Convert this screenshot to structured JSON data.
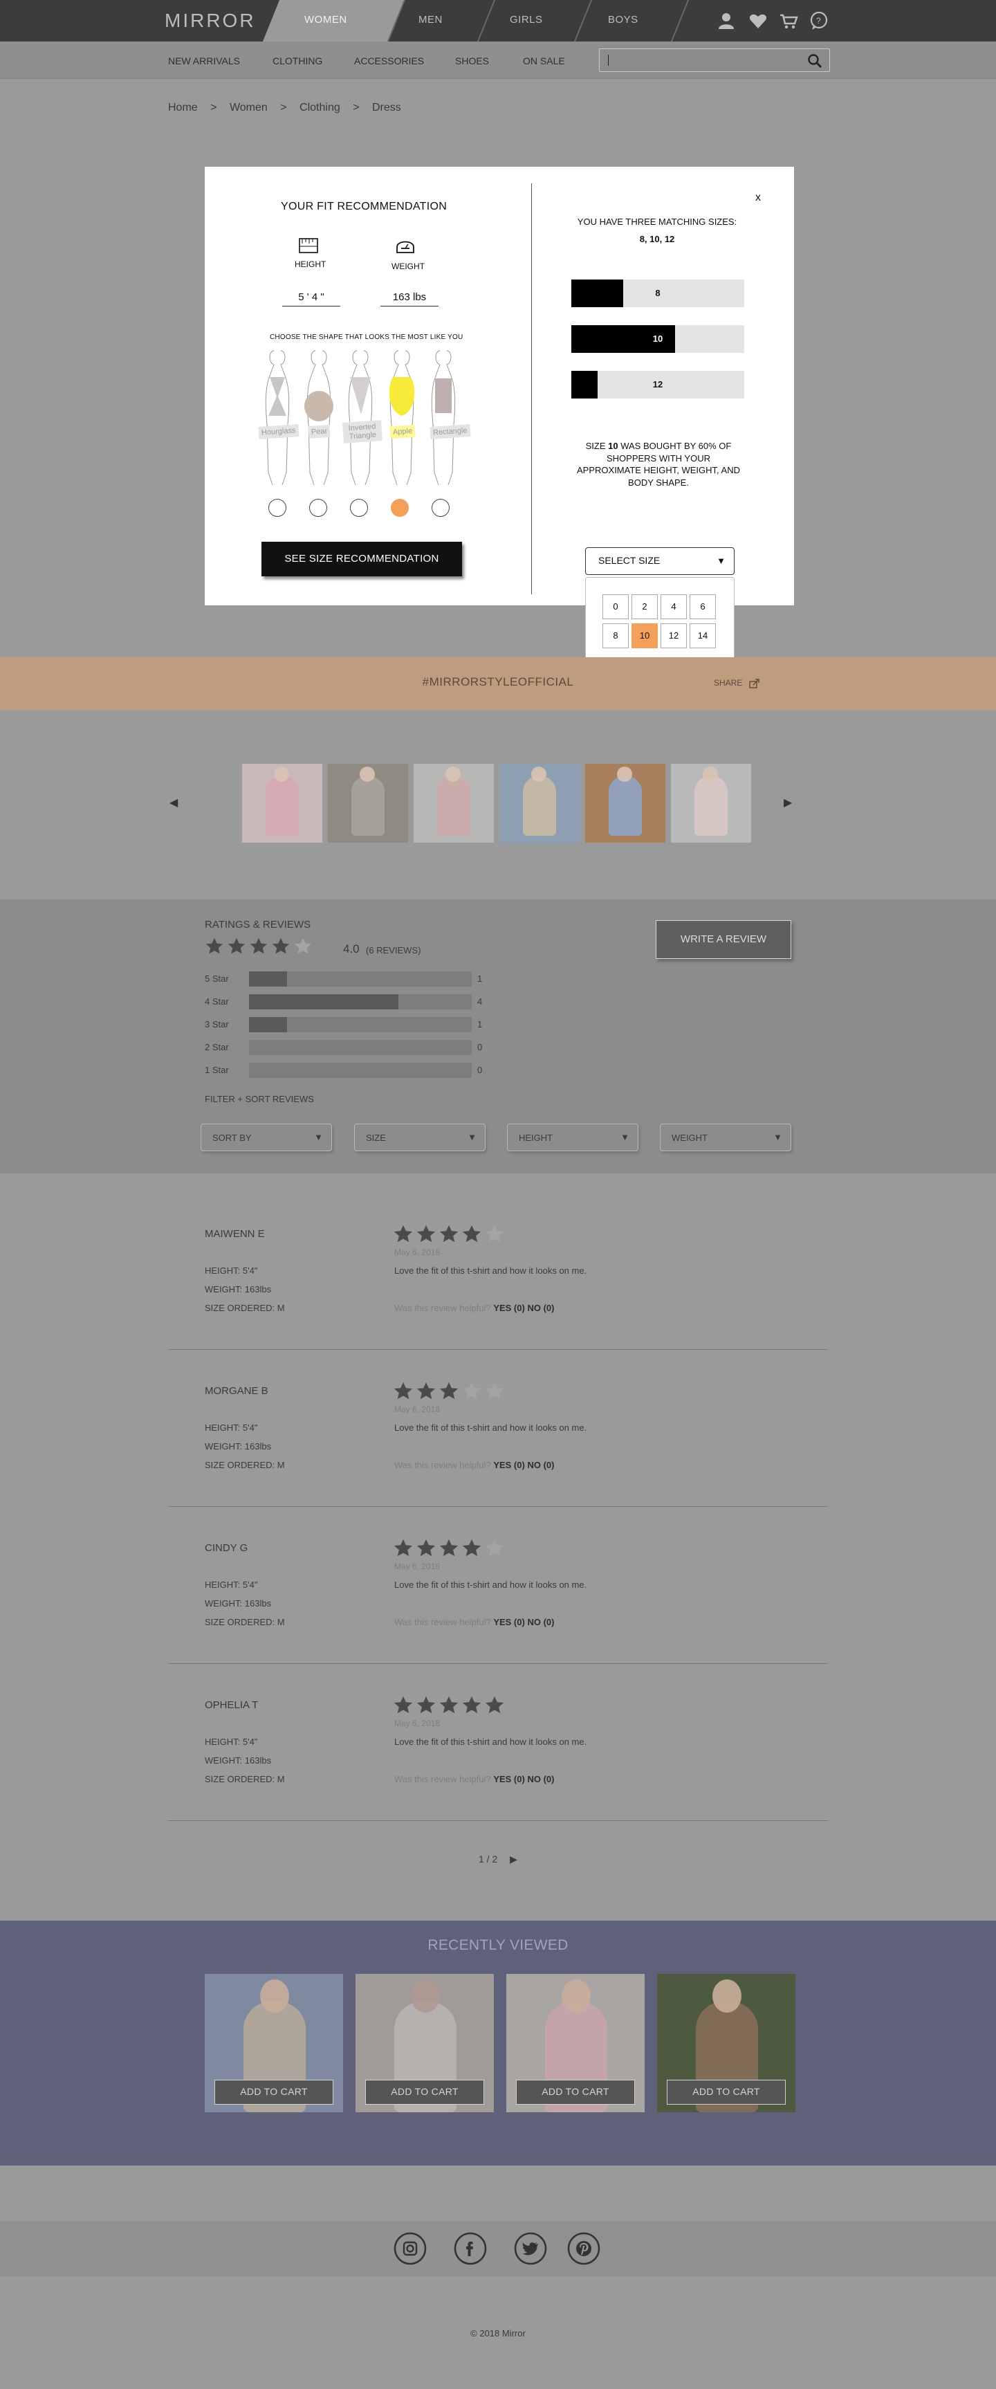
{
  "header": {
    "logo": "MIRROR",
    "tabs": [
      {
        "label": "WOMEN",
        "active": true
      },
      {
        "label": "MEN",
        "active": false
      },
      {
        "label": "GIRLS",
        "active": false
      },
      {
        "label": "BOYS",
        "active": false
      }
    ],
    "icons": [
      "user-icon",
      "heart-icon",
      "cart-icon",
      "chat-icon"
    ]
  },
  "subnav": {
    "items": [
      "NEW ARRIVALS",
      "CLOTHING",
      "ACCESSORIES",
      "SHOES",
      "ON SALE"
    ],
    "search_placeholder": ""
  },
  "breadcrumb": [
    "Home",
    ">",
    "Women",
    ">",
    "Clothing",
    ">",
    "Dress"
  ],
  "fit_modal": {
    "close": "x",
    "title": "YOUR FIT RECOMMENDATION",
    "height_label": "HEIGHT",
    "weight_label": "WEIGHT",
    "height_value": "5 ' 4 \"",
    "weight_value": "163  lbs",
    "shape_prompt": "CHOOSE THE SHAPE THAT LOOKS THE MOST LIKE YOU",
    "shapes": [
      {
        "label": "Hourglass",
        "color": "#c9c4c8",
        "selected": false
      },
      {
        "label": "Pear",
        "color": "#c8b9ac",
        "selected": false
      },
      {
        "label": "Inverted Triangle",
        "color": "#d3cfd1",
        "selected": false
      },
      {
        "label": "Apple",
        "color": "#f7ea3a",
        "selected": true
      },
      {
        "label": "Rectangle",
        "color": "#bdaeb0",
        "selected": false
      }
    ],
    "see_button": "SEE SIZE RECOMMENDATION",
    "match_heading": "YOU HAVE THREE MATCHING SIZES:",
    "match_sizes": "8, 10, 12",
    "size_bars": [
      {
        "label": "8",
        "fraction": 0.3
      },
      {
        "label": "10",
        "fraction": 0.6
      },
      {
        "label": "12",
        "fraction": 0.15
      }
    ],
    "note_pre": "SIZE ",
    "note_size": "10",
    "note_post": " WAS BOUGHT BY 60% OF SHOPPERS WITH YOUR APPROXIMATE HEIGHT, WEIGHT, AND BODY SHAPE.",
    "select_label": "SELECT SIZE",
    "size_options": [
      "0",
      "2",
      "4",
      "6",
      "8",
      "10",
      "12",
      "14"
    ],
    "selected_size": "10"
  },
  "hashtag": {
    "text": "#MIRRORSTYLEOFFICIAL",
    "share": "SHARE"
  },
  "gallery": {
    "prev": "◀",
    "next": "▶",
    "thumbs": [
      {
        "bg": "#c9b8b9",
        "accent": "#d7a7b4"
      },
      {
        "bg": "#8f8a82",
        "accent": "#aaa59d"
      },
      {
        "bg": "#b9b7b5",
        "accent": "#cfa9a9"
      },
      {
        "bg": "#8d9fb0",
        "accent": "#cdbba7"
      },
      {
        "bg": "#a8805e",
        "accent": "#8ea6c9"
      },
      {
        "bg": "#b9b9b9",
        "accent": "#d9c7c4"
      }
    ]
  },
  "ratings": {
    "title": "RATINGS & REVIEWS",
    "average": "4.0",
    "average_stars": 4,
    "count_text": "(6 REVIEWS)",
    "write_button": "WRITE A REVIEW",
    "histogram": [
      {
        "label": "5 Star",
        "count": "1",
        "fraction": 0.17
      },
      {
        "label": "4 Star",
        "count": "4",
        "fraction": 0.67
      },
      {
        "label": "3 Star",
        "count": "1",
        "fraction": 0.17
      },
      {
        "label": "2 Star",
        "count": "0",
        "fraction": 0
      },
      {
        "label": "1 Star",
        "count": "0",
        "fraction": 0
      }
    ],
    "filter_title": "FILTER + SORT REVIEWS",
    "filters": [
      "SORT BY",
      "SIZE",
      "HEIGHT",
      "WEIGHT"
    ]
  },
  "reviews": [
    {
      "name": "MAIWENN E",
      "stars": 4,
      "date": "May 6, 2018",
      "height": "HEIGHT: 5'4\"",
      "weight": "WEIGHT: 163lbs",
      "size": "SIZE ORDERED: M",
      "text": "Love the fit of this t-shirt and how it looks on me.",
      "helpful": "Was this review helpful?",
      "yes": "YES (0)",
      "no": "NO (0)"
    },
    {
      "name": "MORGANE B",
      "stars": 3,
      "date": "May 6, 2018",
      "height": "HEIGHT: 5'4\"",
      "weight": "WEIGHT: 163lbs",
      "size": "SIZE ORDERED: M",
      "text": "Love the fit of this t-shirt and how it looks on me.",
      "helpful": "Was this review helpful?",
      "yes": "YES (0)",
      "no": "NO (0)"
    },
    {
      "name": "CINDY G",
      "stars": 4,
      "date": "May 6, 2018",
      "height": "HEIGHT: 5'4\"",
      "weight": "WEIGHT: 163lbs",
      "size": "SIZE ORDERED: M",
      "text": "Love the fit of this t-shirt and how it looks on me.",
      "helpful": "Was this review helpful?",
      "yes": "YES (0)",
      "no": "NO (0)"
    },
    {
      "name": "OPHELIA T",
      "stars": 5,
      "date": "May 6, 2018",
      "height": "HEIGHT: 5'4\"",
      "weight": "WEIGHT: 163lbs",
      "size": "SIZE ORDERED: M",
      "text": "Love the fit of this t-shirt and how it looks on me.",
      "helpful": "Was this review helpful?",
      "yes": "YES (0)",
      "no": "NO (0)"
    }
  ],
  "pager": {
    "text": "1 / 2",
    "next": "▶"
  },
  "recently_viewed": {
    "title": "RECENTLY VIEWED",
    "cards": [
      {
        "button": "ADD TO CART",
        "bg": "#7f8aa0",
        "accent": "#b9a99a"
      },
      {
        "button": "ADD TO CART",
        "bg": "#b6aea4",
        "accent": "#d8d0c6"
      },
      {
        "button": "ADD TO CART",
        "bg": "#a9a5a3",
        "accent": "#c9a3ad"
      },
      {
        "button": "ADD TO CART",
        "bg": "#4d5a3f",
        "accent": "#8a6e5b"
      }
    ]
  },
  "footer": {
    "social": [
      "instagram-icon",
      "facebook-icon",
      "twitter-icon",
      "pinterest-icon"
    ],
    "copyright": "© 2018 Mirror"
  }
}
